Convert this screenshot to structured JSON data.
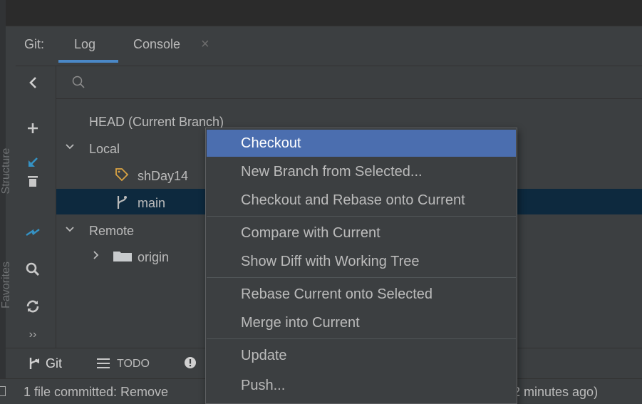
{
  "tool_window": {
    "title": "Git:",
    "tabs": [
      {
        "label": "Log",
        "active": true
      },
      {
        "label": "Console",
        "active": false,
        "close_glyph": "×"
      }
    ]
  },
  "side_labels": [
    "Structure",
    "Favorites"
  ],
  "toolbar": {
    "items": [
      {
        "icon": "chevron-left-icon"
      },
      {
        "icon": "plus-icon"
      },
      {
        "icon": "arrow-down-left-icon",
        "color": "#3592c4"
      },
      {
        "icon": "trash-icon"
      },
      {
        "icon": "compare-arrows-icon",
        "color": "#3592c4"
      },
      {
        "icon": "search-icon"
      },
      {
        "icon": "refresh-icon"
      },
      {
        "icon": "more-icon",
        "glyph": "››"
      }
    ]
  },
  "search": {
    "placeholder": "",
    "icon": "search-icon"
  },
  "tree": {
    "head": "HEAD (Current Branch)",
    "local": {
      "label": "Local",
      "expanded": true,
      "branches": [
        "shDay14",
        "main"
      ],
      "selected": "main"
    },
    "remote": {
      "label": "Remote",
      "expanded": true,
      "children": [
        {
          "label": "origin",
          "expanded": false
        }
      ]
    }
  },
  "bottom_tabs": [
    {
      "label": "Git",
      "icon": "git-icon"
    },
    {
      "label": "TODO",
      "icon": "list-icon"
    },
    {
      "label": "",
      "icon": "problems-icon"
    }
  ],
  "status": {
    "left_text": "1 file committed: Remove",
    "right_text": "2 minutes ago)"
  },
  "context_menu": {
    "groups": [
      [
        "Checkout",
        "New Branch from Selected...",
        "Checkout and Rebase onto Current"
      ],
      [
        "Compare with Current",
        "Show Diff with Working Tree"
      ],
      [
        "Rebase Current onto Selected",
        "Merge into Current"
      ],
      [
        "Update",
        "Push..."
      ]
    ],
    "selected": "Checkout"
  },
  "colors": {
    "background": "#3c3f41",
    "selection": "#4b6eaf",
    "row_selection": "#0d293e",
    "accent": "#4a88c7",
    "tag": "#d9a343"
  }
}
